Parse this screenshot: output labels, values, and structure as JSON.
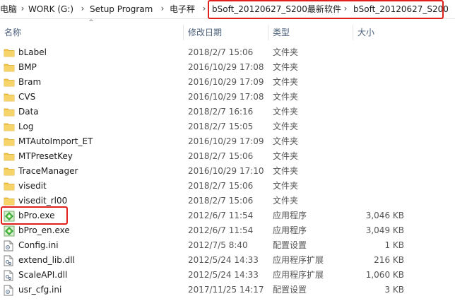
{
  "breadcrumb": {
    "items": [
      "电脑",
      "WORK (G:)",
      "Setup Program",
      "电子秤",
      "bSoft_20120627_S200最新软件",
      "bSoft_20120627_S200"
    ]
  },
  "columns": {
    "name": "名称",
    "date": "修改日期",
    "type": "类型",
    "size": "大小"
  },
  "files": [
    {
      "name": "bLabel",
      "date": "2018/2/7 15:06",
      "type": "文件夹",
      "size": "",
      "icon": "folder-icon"
    },
    {
      "name": "BMP",
      "date": "2016/10/29 17:08",
      "type": "文件夹",
      "size": "",
      "icon": "folder-icon"
    },
    {
      "name": "Bram",
      "date": "2016/10/29 17:09",
      "type": "文件夹",
      "size": "",
      "icon": "folder-icon"
    },
    {
      "name": "CVS",
      "date": "2016/10/29 17:08",
      "type": "文件夹",
      "size": "",
      "icon": "folder-icon"
    },
    {
      "name": "Data",
      "date": "2018/2/7 16:16",
      "type": "文件夹",
      "size": "",
      "icon": "folder-icon"
    },
    {
      "name": "Log",
      "date": "2018/2/7 15:05",
      "type": "文件夹",
      "size": "",
      "icon": "folder-icon"
    },
    {
      "name": "MTAutoImport_ET",
      "date": "2016/10/29 17:09",
      "type": "文件夹",
      "size": "",
      "icon": "folder-icon"
    },
    {
      "name": "MTPresetKey",
      "date": "2018/2/7 15:06",
      "type": "文件夹",
      "size": "",
      "icon": "folder-icon"
    },
    {
      "name": "TraceManager",
      "date": "2016/10/29 17:10",
      "type": "文件夹",
      "size": "",
      "icon": "folder-icon"
    },
    {
      "name": "visedit",
      "date": "2018/2/7 15:06",
      "type": "文件夹",
      "size": "",
      "icon": "folder-icon"
    },
    {
      "name": "visedit_rl00",
      "date": "2018/2/7 15:06",
      "type": "文件夹",
      "size": "",
      "icon": "folder-icon"
    },
    {
      "name": "bPro.exe",
      "date": "2012/6/7 11:54",
      "type": "应用程序",
      "size": "3,046 KB",
      "icon": "exe-icon"
    },
    {
      "name": "bPro_en.exe",
      "date": "2012/6/7 11:54",
      "type": "应用程序",
      "size": "3,049 KB",
      "icon": "exe-icon"
    },
    {
      "name": "Config.ini",
      "date": "2012/7/5 8:40",
      "type": "配置设置",
      "size": "1 KB",
      "icon": "ini-icon"
    },
    {
      "name": "extend_lib.dll",
      "date": "2012/5/24 14:33",
      "type": "应用程序扩展",
      "size": "216 KB",
      "icon": "dll-icon"
    },
    {
      "name": "ScaleAPI.dll",
      "date": "2012/5/24 14:33",
      "type": "应用程序扩展",
      "size": "1,060 KB",
      "icon": "dll-icon"
    },
    {
      "name": "usr_cfg.ini",
      "date": "2017/11/25 14:17",
      "type": "配置设置",
      "size": "3 KB",
      "icon": "ini-icon"
    }
  ],
  "colors": {
    "highlight": "#e0201b",
    "folder": "#f0c64a",
    "header_text": "#4c607a"
  }
}
